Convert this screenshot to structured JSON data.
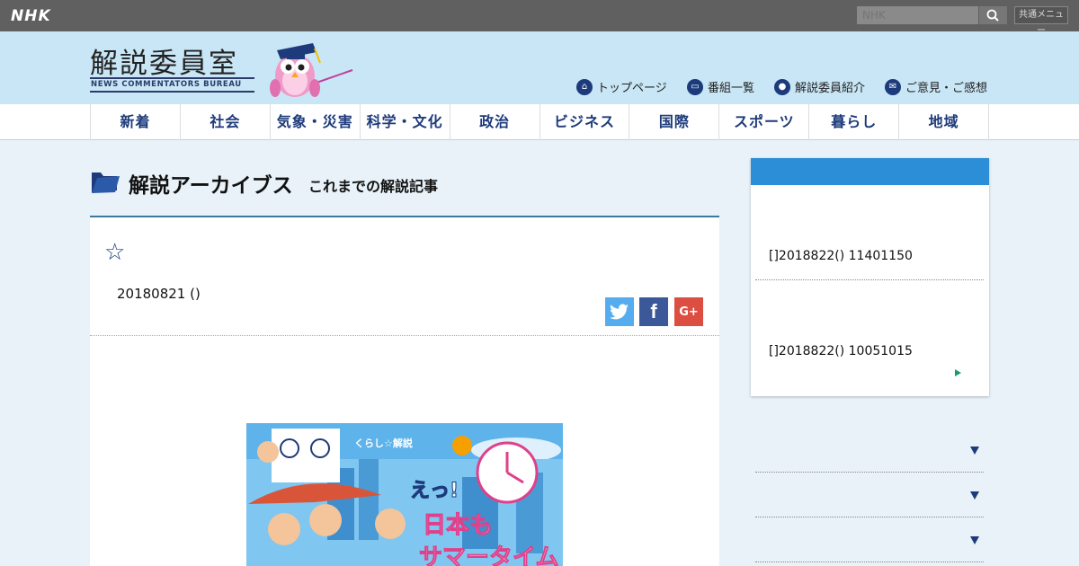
{
  "topbar": {
    "logo": "NHK",
    "search_placeholder": "NHK",
    "common_menu": "共通メニュー"
  },
  "header": {
    "title_jp": "解説委員室",
    "title_en": "NEWS COMMENTATORS BUREAU",
    "links": [
      {
        "label": "トップページ",
        "icon": "home-icon"
      },
      {
        "label": "番組一覧",
        "icon": "tv-icon"
      },
      {
        "label": "解説委員紹介",
        "icon": "person-icon"
      },
      {
        "label": "ご意見・ご感想",
        "icon": "mail-icon"
      }
    ]
  },
  "nav": [
    "新着",
    "社会",
    "気象・災害",
    "科学・文化",
    "政治",
    "ビジネス",
    "国際",
    "スポーツ",
    "暮らし",
    "地域"
  ],
  "page": {
    "heading": "解説アーカイブス",
    "subheading": "これまでの解説記事"
  },
  "article": {
    "star": "☆",
    "date": "20180821 ()",
    "share": {
      "twitter": "t",
      "facebook": "f",
      "google": "G+"
    },
    "image_text": {
      "badge": "くらし☆解説",
      "line1": "えっ!",
      "line2": "日本も",
      "line3": "サマータイム"
    }
  },
  "sidebar": {
    "items": [
      "[]2018822() 11401150",
      "[]2018822() 10051015"
    ]
  },
  "colors": {
    "topbar": "#606060",
    "header_bg": "#c8e6f5",
    "navy": "#1d3a7a",
    "sidebar_head": "#2b8ed6"
  }
}
